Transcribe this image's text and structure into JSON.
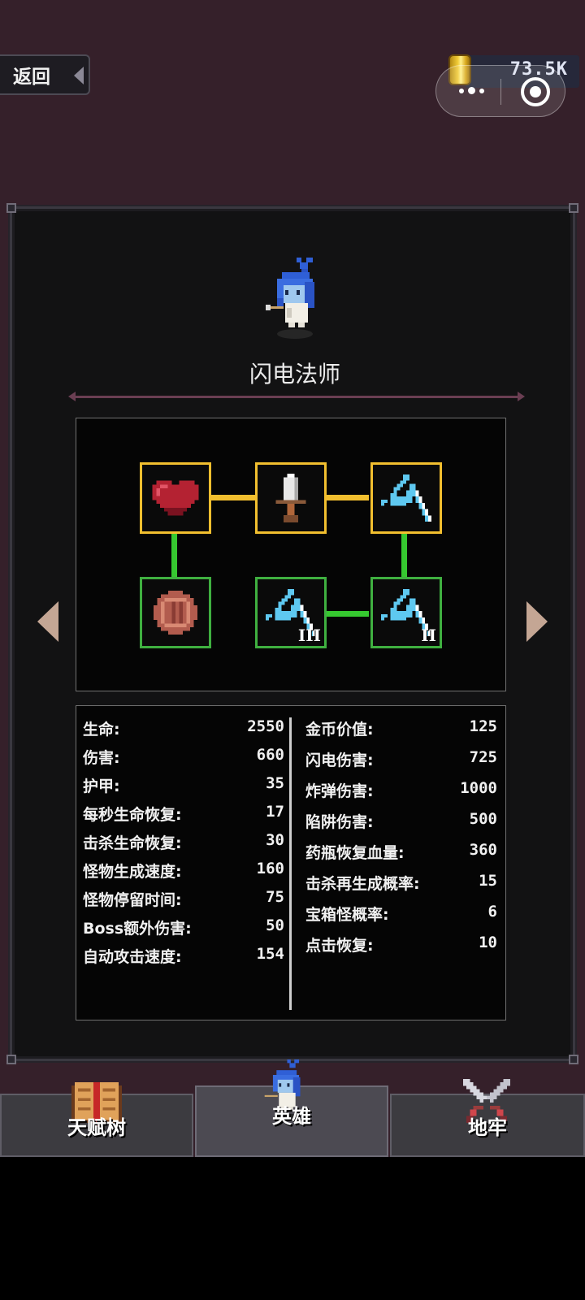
{
  "header": {
    "back_label": "返回",
    "coins": "73.5K"
  },
  "hero": {
    "name": "闪电法师"
  },
  "talent_nodes": [
    {
      "icon": "heart-icon",
      "state": "unlocked"
    },
    {
      "icon": "sword-icon",
      "state": "unlocked"
    },
    {
      "icon": "lightning-icon",
      "state": "unlocked"
    },
    {
      "icon": "shield-icon",
      "state": "available"
    },
    {
      "icon": "lightning-icon",
      "state": "available",
      "tier": "III"
    },
    {
      "icon": "lightning-icon",
      "state": "available",
      "tier": "II"
    }
  ],
  "stats_left": [
    {
      "label": "生命:",
      "value": "2550"
    },
    {
      "label": "伤害:",
      "value": "660"
    },
    {
      "label": "护甲:",
      "value": "35"
    },
    {
      "label": "每秒生命恢复:",
      "value": "17"
    },
    {
      "label": "击杀生命恢复:",
      "value": "30"
    },
    {
      "label": "怪物生成速度:",
      "value": "160"
    },
    {
      "label": "怪物停留时间:",
      "value": "75"
    },
    {
      "label": "Boss额外伤害:",
      "value": "50"
    },
    {
      "label": "自动攻击速度:",
      "value": "154"
    }
  ],
  "stats_right": [
    {
      "label": "金币价值:",
      "value": "125"
    },
    {
      "label": "闪电伤害:",
      "value": "725"
    },
    {
      "label": "炸弹伤害:",
      "value": "1000"
    },
    {
      "label": "陷阱伤害:",
      "value": "500"
    },
    {
      "label": "药瓶恢复血量:",
      "value": "360"
    },
    {
      "label": "击杀再生成概率:",
      "value": "15"
    },
    {
      "label": "宝箱怪概率:",
      "value": "6"
    },
    {
      "label": "点击恢复:",
      "value": "10"
    }
  ],
  "tabs": {
    "talent": "天赋树",
    "hero": "英雄",
    "dungeon": "地牢"
  },
  "colors": {
    "background": "#35202a",
    "unlocked_border": "#f2bf2f",
    "available_border": "#3fb040",
    "lightning": "#5ec8f0"
  }
}
